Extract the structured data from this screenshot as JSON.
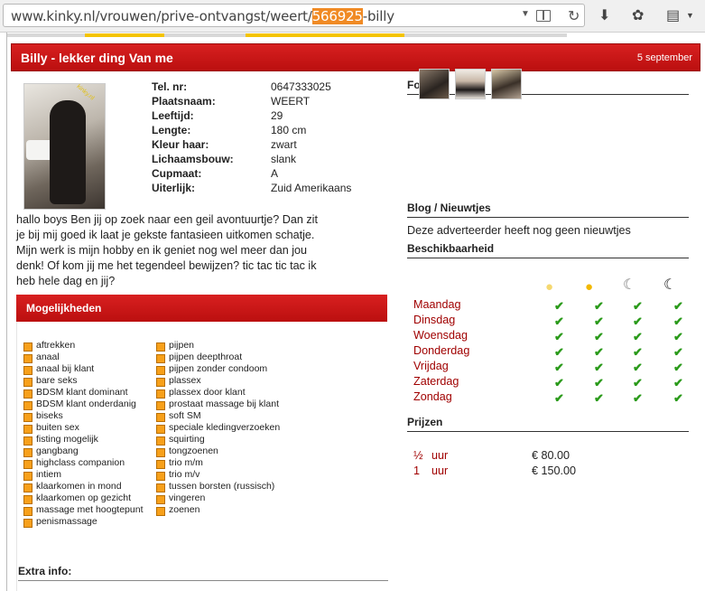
{
  "browser": {
    "url_prefix": "www.kinky.nl/vrouwen/prive-ontvangst/weert/",
    "url_selected": "566925",
    "url_suffix": "-billy"
  },
  "ad": {
    "title": "Billy - lekker ding Van me",
    "date": "5 september"
  },
  "profile": [
    {
      "label": "Tel. nr:",
      "value": "0647333025"
    },
    {
      "label": "Plaatsnaam:",
      "value": "WEERT"
    },
    {
      "label": "Leeftijd:",
      "value": "29"
    },
    {
      "label": "Lengte:",
      "value": "180 cm"
    },
    {
      "label": "Kleur haar:",
      "value": "zwart"
    },
    {
      "label": "Lichaamsbouw:",
      "value": "slank"
    },
    {
      "label": "Cupmaat:",
      "value": "A"
    },
    {
      "label": "Uiterlijk:",
      "value": "Zuid Amerikaans"
    }
  ],
  "description_lines": [
    "hallo boys Ben jij op zoek naar een geil avontuurtje? Dan zit",
    "je bij mij goed ik laat je gekste fantasieen uitkomen schatje.",
    "Mijn werk is mijn hobby en ik geniet nog wel meer dan jou",
    "denk! Of kom jij me het tegendeel bewijzen? tic tac tic tac ik",
    "heb hele dag en jij?"
  ],
  "options_title": "Mogelijkheden",
  "options_col1": [
    "aftrekken",
    "anaal",
    "anaal bij klant",
    "bare seks",
    "BDSM klant dominant",
    "BDSM klant onderdanig",
    "biseks",
    "buiten sex",
    "fisting mogelijk",
    "gangbang",
    "highclass companion",
    "intiem",
    "klaarkomen in mond",
    "klaarkomen op gezicht",
    "massage met hoogtepunt",
    "penismassage"
  ],
  "options_col2": [
    "pijpen",
    "pijpen deepthroat",
    "pijpen zonder condoom",
    "plassex",
    "plassex door klant",
    "prostaat massage bij klant",
    "soft SM",
    "speciale kledingverzoeken",
    "squirting",
    "tongzoenen",
    "trio m/m",
    "trio m/v",
    "tussen borsten (russisch)",
    "vingeren",
    "zoenen"
  ],
  "extra_info_title": "Extra info:",
  "photos_title": "Foto's",
  "blog_title": "Blog / Nieuwtjes",
  "blog_text": "Deze adverteerder heeft nog geen nieuwtjes",
  "availability_title": "Beschikbaarheid",
  "availability_icons": [
    "morning-sun-icon",
    "afternoon-sun-icon",
    "evening-moon-icon",
    "night-moon-icon"
  ],
  "days": [
    "Maandag",
    "Dinsdag",
    "Woensdag",
    "Donderdag",
    "Vrijdag",
    "Zaterdag",
    "Zondag"
  ],
  "availability": [
    [
      true,
      true,
      true,
      true
    ],
    [
      true,
      true,
      true,
      true
    ],
    [
      true,
      true,
      true,
      true
    ],
    [
      true,
      true,
      true,
      true
    ],
    [
      true,
      true,
      true,
      true
    ],
    [
      true,
      true,
      true,
      true
    ],
    [
      true,
      true,
      true,
      true
    ]
  ],
  "prices_title": "Prijzen",
  "prices": [
    {
      "quantity": "½",
      "unit": "uur",
      "price": "€ 80.00"
    },
    {
      "quantity": "1",
      "unit": "uur",
      "price": "€ 150.00"
    }
  ],
  "colors": {
    "header_red": "#cc1414",
    "day_red": "#a00000",
    "check_green": "#2a9a1a",
    "bullet_orange": "#f7a01a",
    "url_highlight": "#f08a24"
  }
}
